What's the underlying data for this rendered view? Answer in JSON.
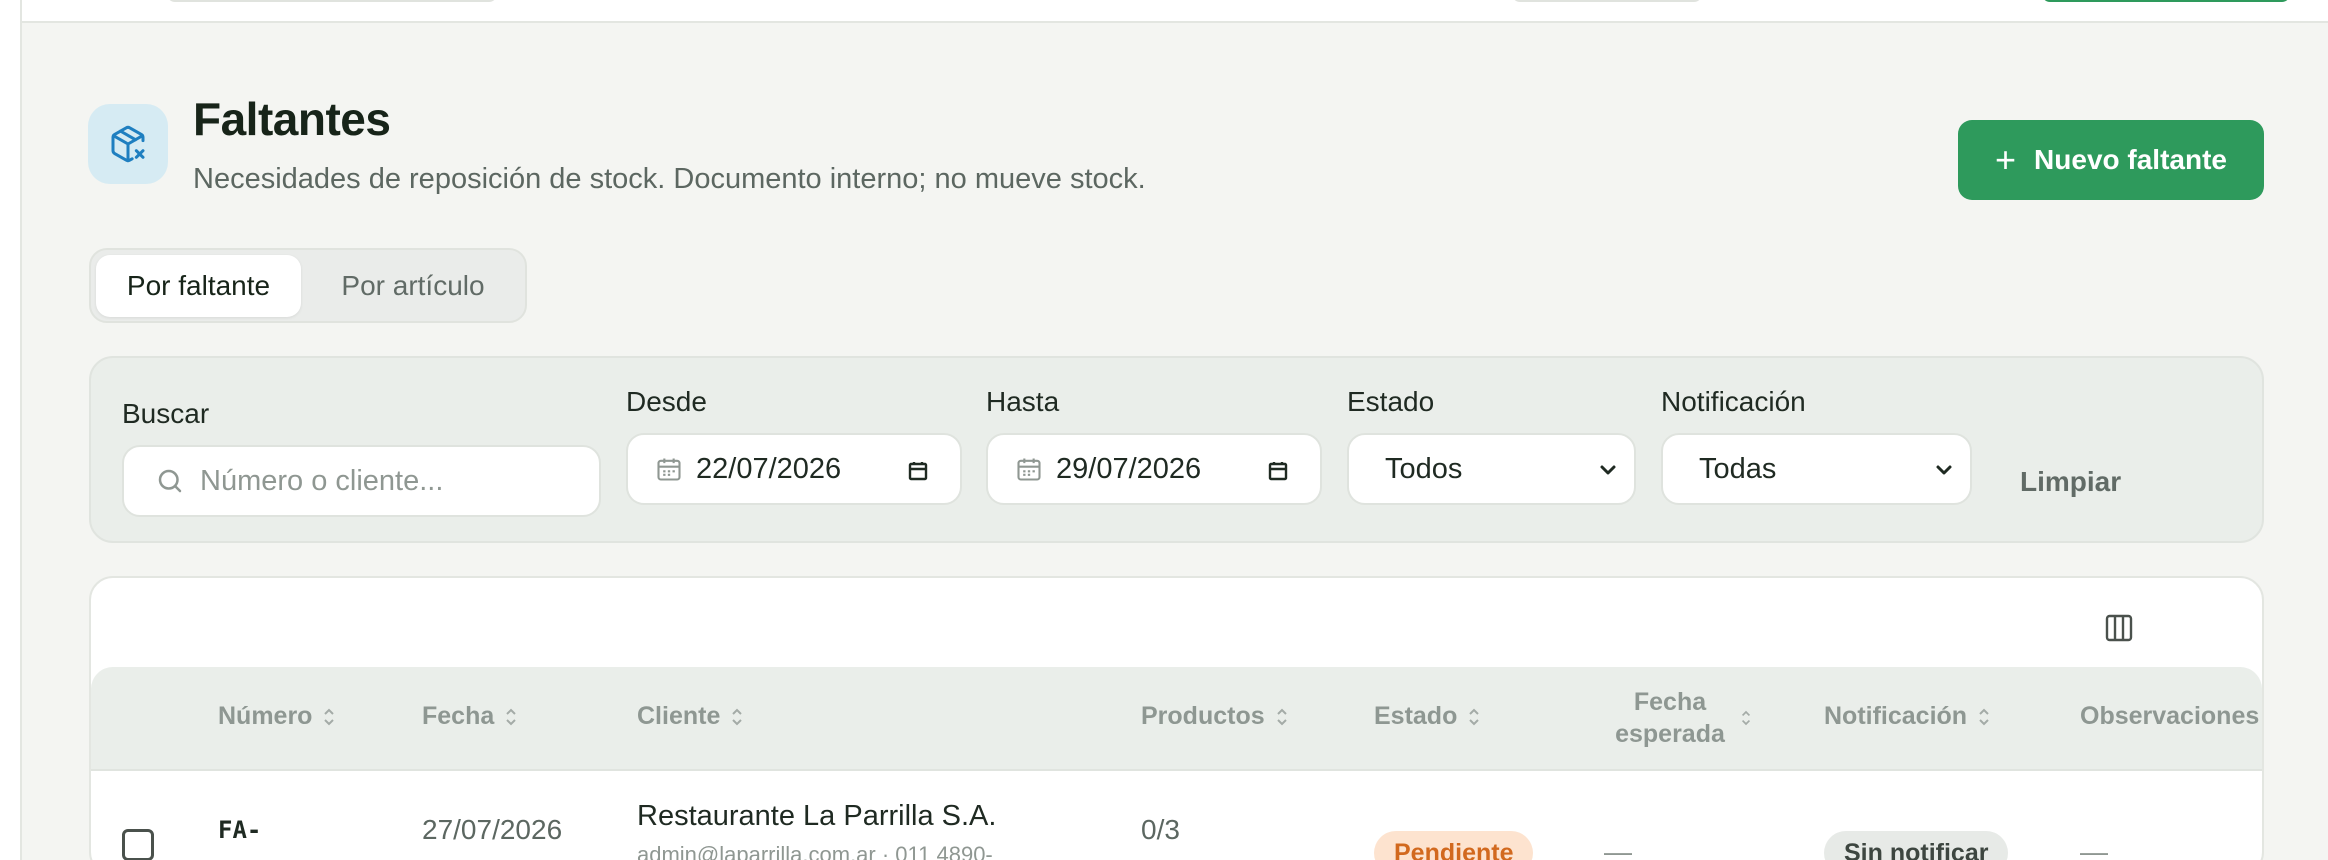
{
  "header": {
    "title": "Faltantes",
    "subtitle": "Necesidades de reposición de stock. Documento interno; no mueve stock.",
    "new_button_label": "Nuevo faltante"
  },
  "view_tabs": [
    {
      "label": "Por faltante",
      "active": true
    },
    {
      "label": "Por artículo",
      "active": false
    }
  ],
  "filters": {
    "search_label": "Buscar",
    "search_placeholder": "Número o cliente...",
    "from_label": "Desde",
    "from_value": "22/07/2026",
    "to_label": "Hasta",
    "to_value": "29/07/2026",
    "status_label": "Estado",
    "status_value": "Todos",
    "notification_label": "Notificación",
    "notification_value": "Todas",
    "clear_label": "Limpiar"
  },
  "table": {
    "columns": [
      "Número",
      "Fecha",
      "Cliente",
      "Productos",
      "Estado",
      "Fecha esperada",
      "Notificación",
      "Observaciones"
    ],
    "rows": [
      {
        "numero": "FA-",
        "fecha": "27/07/2026",
        "cliente": "Restaurante La Parrilla S.A.",
        "cliente_detalle": "admin@laparrilla.com.ar · 011 4890-",
        "productos": "0/3",
        "estado": "Pendiente",
        "fecha_esperada": "—",
        "notificacion": "Sin notificar",
        "observaciones": "—"
      }
    ]
  },
  "colors": {
    "accent": "#2e9a5c",
    "icon_bg": "#d6ebf3",
    "icon_fg": "#1f7fc0",
    "pending_bg": "#fde3cf",
    "pending_fg": "#d2691e"
  },
  "icons": {
    "page": "package-x-icon",
    "add": "plus-icon",
    "search": "search-icon",
    "calendar": "calendar-icon",
    "columns": "columns-icon",
    "sort": "sort-icon"
  }
}
